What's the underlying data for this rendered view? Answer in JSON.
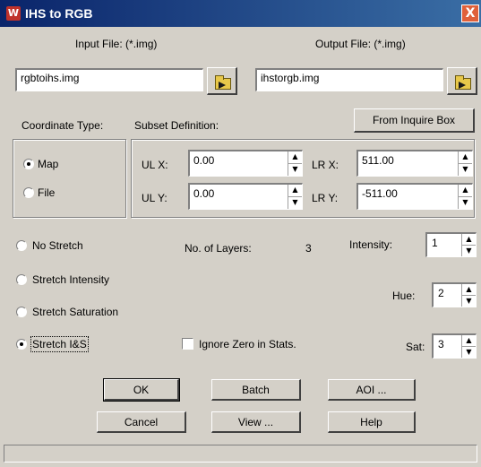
{
  "window": {
    "title": "IHS to RGB",
    "close_glyph": "X",
    "icon_letter": "W"
  },
  "input": {
    "label": "Input File: (*.img)",
    "value": "rgbtoihs.img"
  },
  "output": {
    "label": "Output File: (*.img)",
    "value": "ihstorgb.img"
  },
  "coordinate": {
    "label": "Coordinate Type:",
    "options": [
      "Map",
      "File"
    ],
    "selected": "Map"
  },
  "subset": {
    "label": "Subset Definition:",
    "from_inquire_label": "From Inquire Box",
    "ulx_label": "UL X:",
    "ulx_value": "0.00",
    "uly_label": "UL Y:",
    "uly_value": "0.00",
    "lrx_label": "LR X:",
    "lrx_value": "511.00",
    "lry_label": "LR Y:",
    "lry_value": "-511.00"
  },
  "stretch": {
    "options": [
      "No Stretch",
      "Stretch Intensity",
      "Stretch Saturation",
      "Stretch I&S"
    ],
    "selected": "Stretch I&S"
  },
  "layers": {
    "label": "No. of Layers:",
    "value": "3"
  },
  "mapping": {
    "intensity_label": "Intensity:",
    "intensity_value": "1",
    "hue_label": "Hue:",
    "hue_value": "2",
    "sat_label": "Sat:",
    "sat_value": "3"
  },
  "ignore_zero": {
    "label": "Ignore Zero in Stats.",
    "checked": false
  },
  "buttons": {
    "ok": "OK",
    "batch": "Batch",
    "aoi": "AOI ...",
    "cancel": "Cancel",
    "view": "View ...",
    "help": "Help"
  },
  "icons": {
    "folder": "open-folder-icon",
    "spin_up": "▲",
    "spin_down": "▼"
  },
  "colors": {
    "titlebar_start": "#0a246a",
    "titlebar_end": "#3a6ea5",
    "close": "#e0603a",
    "dialog_bg": "#d4d0c8"
  }
}
